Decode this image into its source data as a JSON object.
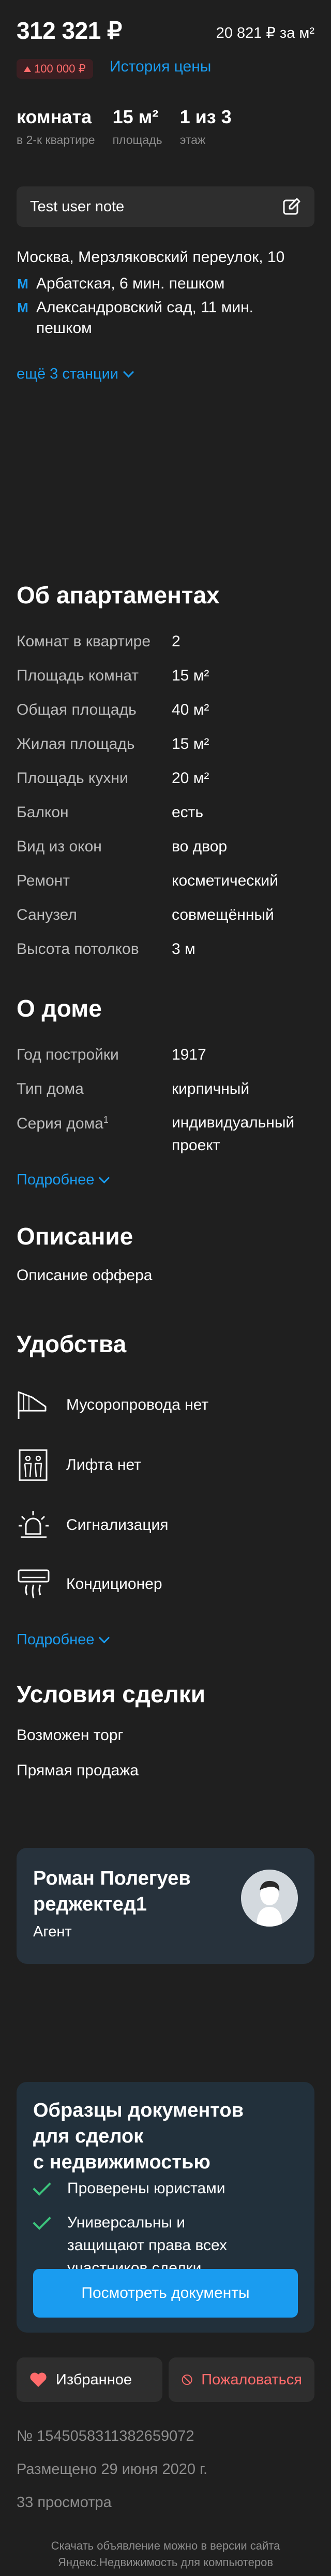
{
  "header": {
    "price": "312 321 ₽",
    "price_per_m2": "20 821 ₽ за м²",
    "price_change": "100 000 ₽",
    "history_link": "История цены"
  },
  "specs": [
    {
      "value": "комната",
      "label": "в 2-к квартире"
    },
    {
      "value": "15 м²",
      "label": "площадь"
    },
    {
      "value": "1 из 3",
      "label": "этаж"
    }
  ],
  "note": {
    "text": "Test user note",
    "icon": "edit-icon"
  },
  "location": {
    "address": "Москва, Мерзляковский переулок, 10",
    "metro": [
      {
        "line1": "Арбатская, 6 мин. пешком",
        "line2": ""
      },
      {
        "line1": "Александровский сад, 11 мин.",
        "line2": "пешком"
      }
    ],
    "more_stations": "ещё 3 станции"
  },
  "apartment": {
    "title": "Об апартаментах",
    "rows": [
      {
        "k": "Комнат в квартире",
        "v": "2"
      },
      {
        "k": "Площадь комнат",
        "v": "15 м²"
      },
      {
        "k": "Общая площадь",
        "v": "40 м²"
      },
      {
        "k": "Жилая площадь",
        "v": "15 м²"
      },
      {
        "k": "Площадь кухни",
        "v": "20 м²"
      },
      {
        "k": "Балкон",
        "v": "есть"
      },
      {
        "k": "Вид из окон",
        "v": "во двор"
      },
      {
        "k": "Ремонт",
        "v": "косметический"
      },
      {
        "k": "Санузел",
        "v": "совмещённый"
      },
      {
        "k": "Высота потолков",
        "v": "3 м"
      }
    ]
  },
  "house": {
    "title": "О доме",
    "rows": [
      {
        "k": "Год постройки",
        "v": "1917"
      },
      {
        "k": "Тип дома",
        "v": "кирпичный"
      },
      {
        "k": "Серия дома",
        "sup": "1",
        "v": "индивидуальный проект"
      }
    ],
    "more": "Подробнее"
  },
  "description": {
    "title": "Описание",
    "text": "Описание оффера"
  },
  "amenities": {
    "title": "Удобства",
    "items": [
      {
        "icon": "garbage-chute-icon",
        "label": "Мусоропровода нет"
      },
      {
        "icon": "elevator-icon",
        "label": "Лифта нет"
      },
      {
        "icon": "alarm-icon",
        "label": "Сигнализация"
      },
      {
        "icon": "air-conditioner-icon",
        "label": "Кондиционер"
      }
    ],
    "more": "Подробнее"
  },
  "deal": {
    "title": "Условия сделки",
    "items": [
      "Возможен торг",
      "Прямая продажа"
    ]
  },
  "agent": {
    "name_line1": "Роман Полегуев",
    "name_line2": "реджектед1",
    "role": "Агент"
  },
  "docs": {
    "title_lines": [
      "Образцы документов",
      "для сделок",
      "с недвижимостью"
    ],
    "items": [
      "Проверены юристами",
      "Универсальны и защищают права всех участников сделки"
    ],
    "button": "Посмотреть документы"
  },
  "actions": {
    "favorite": "Избранное",
    "complain": "Пожаловаться"
  },
  "meta": {
    "id": "№ 1545058311382659072",
    "placed": "Размещено 29 июня 2020 г.",
    "views": "33 просмотра"
  },
  "footer": {
    "line1": "Скачать объявление можно в версии сайта",
    "line2": "Яндекс.Недвижимость для компьютеров"
  },
  "colors": {
    "accent": "#1a9cf0",
    "danger": "#ff6b6b",
    "success": "#3cc47c",
    "background": "#1f1f1f"
  }
}
